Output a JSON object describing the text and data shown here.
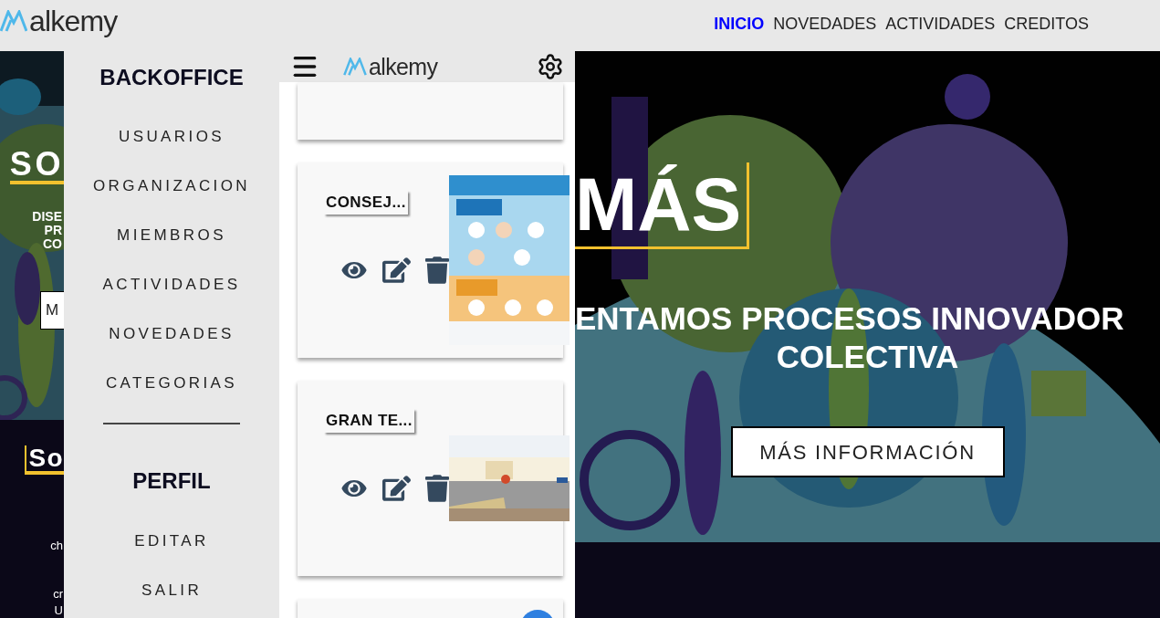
{
  "top_bar": {
    "logo": "alkemy",
    "nav": [
      {
        "label": "INICIO",
        "selected": true
      },
      {
        "label": "NOVEDADES",
        "selected": false
      },
      {
        "label": "ACTIVIDADES",
        "selected": false
      },
      {
        "label": "CREDITOS",
        "selected": false
      }
    ]
  },
  "background_strip": {
    "hero_title": "SO",
    "hero_lines": [
      "DISE",
      "PR",
      "CO"
    ],
    "hero_button": "M",
    "section_title": "So",
    "lines": [
      "ch",
      "cr",
      "U"
    ]
  },
  "sidebar": {
    "sections": [
      {
        "title": "BACKOFFICE",
        "items": [
          "USUARIOS",
          "ORGANIZACION",
          "MIEMBROS",
          "ACTIVIDADES",
          "NOVEDADES",
          "CATEGORIAS"
        ]
      },
      {
        "title": "PERFIL",
        "items": [
          "EDITAR",
          "SALIR"
        ]
      }
    ]
  },
  "panel": {
    "logo": "alkemy",
    "cards": [
      {
        "kind": "blank"
      },
      {
        "kind": "entry",
        "title": "CONSEJ..."
      },
      {
        "kind": "entry",
        "title": "GRAN TE..."
      },
      {
        "kind": "blank"
      }
    ]
  },
  "hero": {
    "title": "MÁS",
    "subtitle_lines": [
      "ENTAMOS PROCESOS INNOVADOR",
      "COLECTIVA"
    ],
    "button": "MÁS INFORMACIÓN"
  }
}
